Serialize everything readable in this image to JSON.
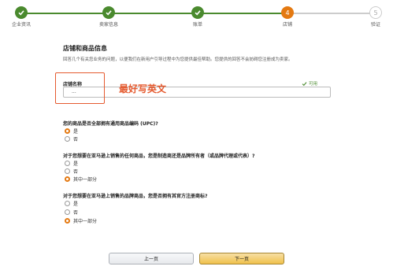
{
  "steps": [
    {
      "label": "企业资讯",
      "state": "done",
      "icon": "check-icon"
    },
    {
      "label": "卖家信息",
      "state": "done",
      "icon": "check-icon"
    },
    {
      "label": "账单",
      "state": "done",
      "icon": "check-icon"
    },
    {
      "label": "店铺",
      "state": "current",
      "number": "4"
    },
    {
      "label": "验证",
      "state": "pending",
      "number": "5"
    }
  ],
  "colors": {
    "done": "#4a8a2e",
    "current": "#e47911",
    "pending": "#cccccc",
    "annotation": "#e55a2f"
  },
  "section": {
    "title": "店铺和商品信息",
    "description": "回答几个有关您业务的问题，以便我们在新用户引导过程中为您提供最佳帮助。您提供的回答不会妨碍您注册成为卖家。"
  },
  "store_name": {
    "label": "店铺名称",
    "value": "...",
    "availability": "可用"
  },
  "annotation_text": "最好写英文",
  "questions": [
    {
      "text": "您的商品是否全部拥有通用商品编码 (UPC)?",
      "options": [
        {
          "label": "是",
          "selected": true
        },
        {
          "label": "否",
          "selected": false
        }
      ]
    },
    {
      "text": "对于您想要在亚马逊上销售的任何商品，您是制造商还是品牌所有者（或品牌代理或代表）?",
      "options": [
        {
          "label": "是",
          "selected": false
        },
        {
          "label": "否",
          "selected": false
        },
        {
          "label": "其中一部分",
          "selected": true
        }
      ]
    },
    {
      "text": "对于您想要在亚马逊上销售的品牌商品，您是否拥有其官方注册商标?",
      "options": [
        {
          "label": "是",
          "selected": false
        },
        {
          "label": "否",
          "selected": false
        },
        {
          "label": "其中一部分",
          "selected": true
        }
      ]
    }
  ],
  "buttons": {
    "prev": "上一页",
    "next": "下一页"
  }
}
